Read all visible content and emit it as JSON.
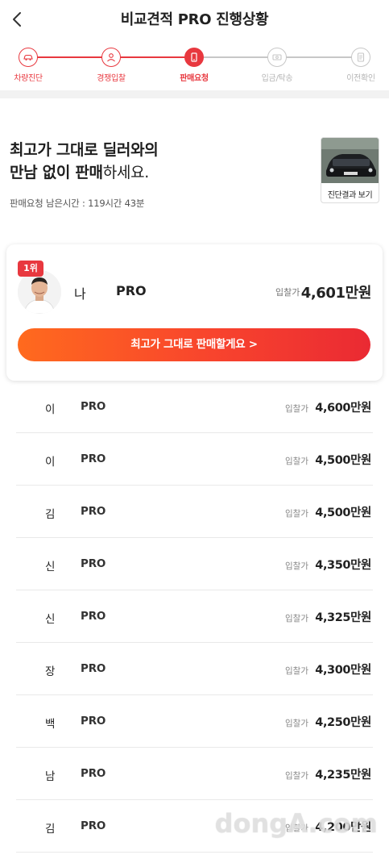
{
  "header": {
    "title": "비교견적 PRO 진행상황"
  },
  "steps": [
    {
      "label": "차량진단",
      "status": "done",
      "icon": "car-icon"
    },
    {
      "label": "경쟁입찰",
      "status": "done",
      "icon": "people-icon"
    },
    {
      "label": "판매요청",
      "status": "active",
      "icon": "phone-icon"
    },
    {
      "label": "입금/탁송",
      "status": "todo",
      "icon": "money-icon"
    },
    {
      "label": "이전확인",
      "status": "todo",
      "icon": "document-icon"
    }
  ],
  "hero": {
    "line1": "최고가 그대로 딜러와의",
    "line2_bold": "만남 없이 판매",
    "line2_rest": "하세요.",
    "remaining": "판매요청 남은시간 : 119시간 43분",
    "diagnosis_label": "진단결과 보기"
  },
  "top_bidder": {
    "rank": "1위",
    "name": "나",
    "pro": "PRO",
    "bid_label": "입찰가",
    "bid_value": "4,601만원",
    "cta": "최고가 그대로 판매할게요 >"
  },
  "bidders": [
    {
      "name": "이",
      "pro": "PRO",
      "bid_label": "입찰가",
      "bid": "4,600만원"
    },
    {
      "name": "이",
      "pro": "PRO",
      "bid_label": "입찰가",
      "bid": "4,500만원"
    },
    {
      "name": "김",
      "pro": "PRO",
      "bid_label": "입찰가",
      "bid": "4,500만원"
    },
    {
      "name": "신",
      "pro": "PRO",
      "bid_label": "입찰가",
      "bid": "4,350만원"
    },
    {
      "name": "신",
      "pro": "PRO",
      "bid_label": "입찰가",
      "bid": "4,325만원"
    },
    {
      "name": "장",
      "pro": "PRO",
      "bid_label": "입찰가",
      "bid": "4,300만원"
    },
    {
      "name": "백",
      "pro": "PRO",
      "bid_label": "입찰가",
      "bid": "4,250만원"
    },
    {
      "name": "남",
      "pro": "PRO",
      "bid_label": "입찰가",
      "bid": "4,235만원"
    },
    {
      "name": "김",
      "pro": "PRO",
      "bid_label": "입찰가",
      "bid": "4,200만원"
    }
  ],
  "watermark": "dongA.com",
  "colors": {
    "accent": "#e8383f",
    "cta_start": "#ff6a1e",
    "cta_end": "#ea2a33",
    "inactive": "#c7c7c7"
  }
}
